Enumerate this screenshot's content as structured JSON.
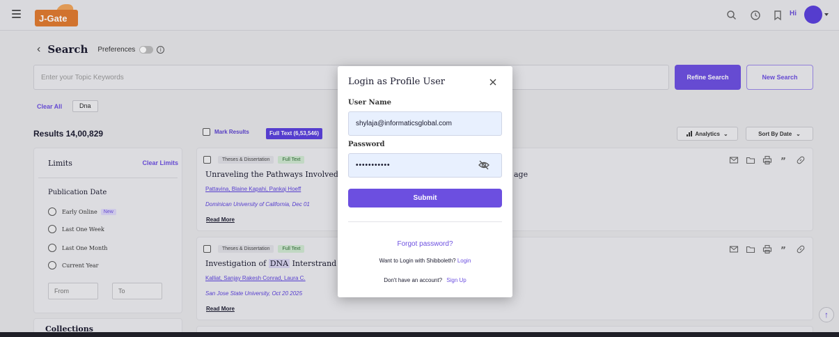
{
  "header": {
    "logo_text": "J-Gate",
    "hi_text": "Hi",
    "icons": [
      "hamburger-icon",
      "search-icon",
      "clock-icon",
      "bookmark-icon"
    ]
  },
  "search": {
    "back_label": "<",
    "title": "Search",
    "preferences_label": "Preferences",
    "placeholder": "Enter your Topic Keywords",
    "refine_label": "Refine Search",
    "new_label": "New Search",
    "clear_all_label": "Clear All",
    "chip": "Dna"
  },
  "results": {
    "count_label": "Results 14,00,829",
    "mark_label": "Mark Results",
    "fulltext_label": "Full Text (6,53,546)",
    "analytics_label": "Analytics",
    "sort_label": "Sort By Date"
  },
  "limits": {
    "title": "Limits",
    "clear_label": "Clear Limits",
    "pubdate_title": "Publication Date",
    "options": [
      "Early Online",
      "Last One Week",
      "Last One Month",
      "Current Year"
    ],
    "new_badge": "New",
    "from_placeholder": "From",
    "to_placeholder": "To",
    "collections_title": "Collections"
  },
  "cards": [
    {
      "type": "Theses & Dissertation",
      "fulltext": "Full Text",
      "title_start": "Unraveling the Pathways Involved in",
      "title_end": "age",
      "authors": "Pattavina, Blaine  Kapahi, Pankaj  Hoeff",
      "source": "Dominican University of California, Dec 01",
      "read_more": "Read More"
    },
    {
      "type": "Theses & Dissertation",
      "fulltext": "Full Text",
      "title_start": "Investigation of",
      "title_hl": "DNA",
      "title_end": "Interstrand C",
      "authors": "Kalliat, Sanjay Rakesh  Conrad, Laura C.",
      "source": "San Jose State University, Oct 20 2025",
      "read_more": "Read More"
    }
  ],
  "modal": {
    "title": "Login as Profile User",
    "username_label": "User Name",
    "username_value": "shylaja@informaticsglobal.com",
    "password_label": "Password",
    "password_value": "•••••••••••",
    "submit_label": "Submit",
    "forgot_label": "Forgot password?",
    "shib_text": "Want to Login with Shibboleth?",
    "shib_link": "Login",
    "signup_text": "Don't have an account?",
    "signup_link": "Sign Up"
  },
  "colors": {
    "accent": "#6c4fe0",
    "logo": "#e07a2e",
    "avatar": "#5a3fdc"
  }
}
